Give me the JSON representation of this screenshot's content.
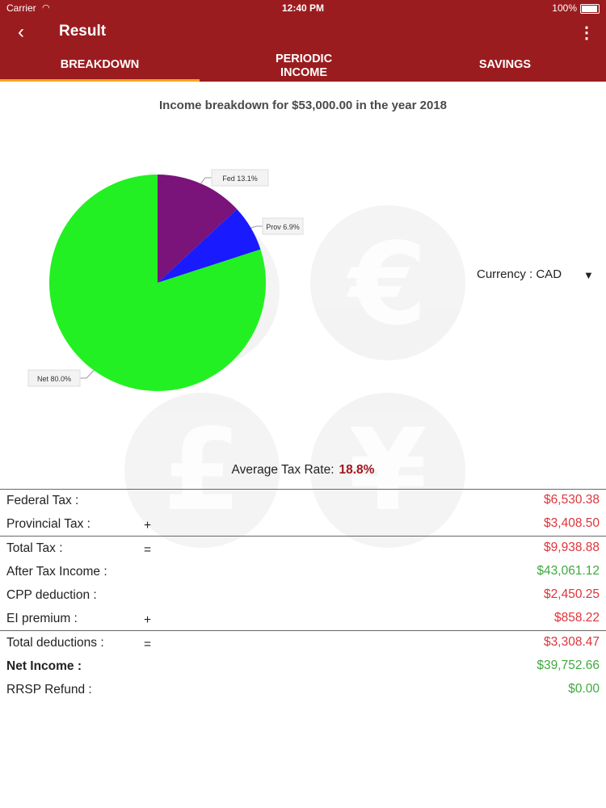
{
  "status": {
    "carrier": "Carrier",
    "time": "12:40 PM",
    "battery": "100%"
  },
  "nav": {
    "back_icon": "‹",
    "title": "Result",
    "more_icon": "⋮"
  },
  "tabs": [
    {
      "label": "BREAKDOWN",
      "selected": true
    },
    {
      "label": "PERIODIC\nINCOME",
      "selected": false
    },
    {
      "label": "SAVINGS",
      "selected": false
    }
  ],
  "heading": "Income breakdown for $53,000.00 in the year 2018",
  "chart_data": {
    "type": "pie",
    "slices": [
      {
        "label": "Fed 13.1%",
        "value": 13.1,
        "color": "#7a137a"
      },
      {
        "label": "Prov 6.9%",
        "value": 6.9,
        "color": "#1a1aff"
      },
      {
        "label": "Net 80.0%",
        "value": 80.0,
        "color": "#22f022"
      }
    ]
  },
  "currency": {
    "label": "Currency : CAD"
  },
  "avg_tax": {
    "label": "Average Tax Rate:",
    "value": "18.8%"
  },
  "rows": [
    {
      "label": "Federal Tax :",
      "op": "",
      "value": "$6,530.38",
      "color": "red"
    },
    {
      "label": "Provincial Tax :",
      "op": "+",
      "value": "$3,408.50",
      "color": "red"
    },
    {
      "label": "Total Tax :",
      "op": "=",
      "value": "$9,938.88",
      "color": "red"
    },
    {
      "label": "After Tax Income :",
      "op": "",
      "value": "$43,061.12",
      "color": "green"
    },
    {
      "label": "CPP deduction :",
      "op": "",
      "value": "$2,450.25",
      "color": "red"
    },
    {
      "label": "EI premium :",
      "op": "+",
      "value": "$858.22",
      "color": "red"
    },
    {
      "label": "Total deductions :",
      "op": "=",
      "value": "$3,308.47",
      "color": "red"
    },
    {
      "label": "Net Income :",
      "op": "",
      "value": "$39,752.66",
      "color": "green"
    },
    {
      "label": "RRSP Refund :",
      "op": "",
      "value": "$0.00",
      "color": "green"
    }
  ]
}
